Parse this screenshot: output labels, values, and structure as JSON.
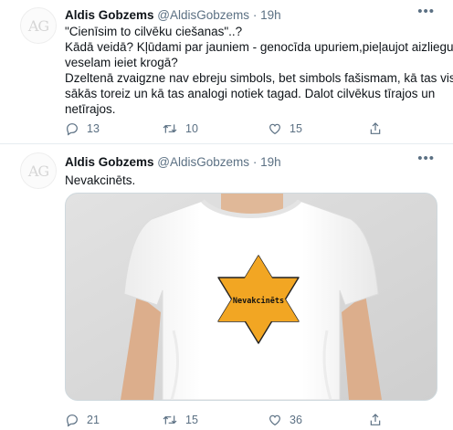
{
  "tweets": [
    {
      "avatar_text": "AG",
      "name": "Aldis Gobzems",
      "handle": "@AldisGobzems",
      "separator": "·",
      "time": "19h",
      "lines": [
        "\"Cienīsim to cilvēku ciešanas\"..?",
        "Kādā veidā? Kļūdami par jauniem - genocīda upuriem,pieļaujot aizliegumu",
        "veselam ieiet krogā?",
        "Dzeltenā zvaigzne nav ebreju simbols, bet simbols fašismam, kā tas viss",
        "sākās toreiz un kā tas analogi notiek tagad. Dalot cilvēkus tīrajos un",
        "netīrajos."
      ],
      "replies": "13",
      "retweets": "10",
      "likes": "15"
    },
    {
      "avatar_text": "AG",
      "name": "Aldis Gobzems",
      "handle": "@AldisGobzems",
      "separator": "·",
      "time": "19h",
      "lines": [
        "Nevakcinēts."
      ],
      "star_label": "Nevakcinēts",
      "replies": "21",
      "retweets": "15",
      "likes": "36"
    }
  ],
  "icons": {
    "more": "more-icon",
    "reply": "reply-icon",
    "retweet": "retweet-icon",
    "like": "heart-icon",
    "share": "share-icon"
  },
  "colors": {
    "text": "#0f1419",
    "secondary": "#5b7083",
    "star": "#f2a623",
    "shirt": "#ffffff",
    "background_photo": "#d9d9d9"
  }
}
